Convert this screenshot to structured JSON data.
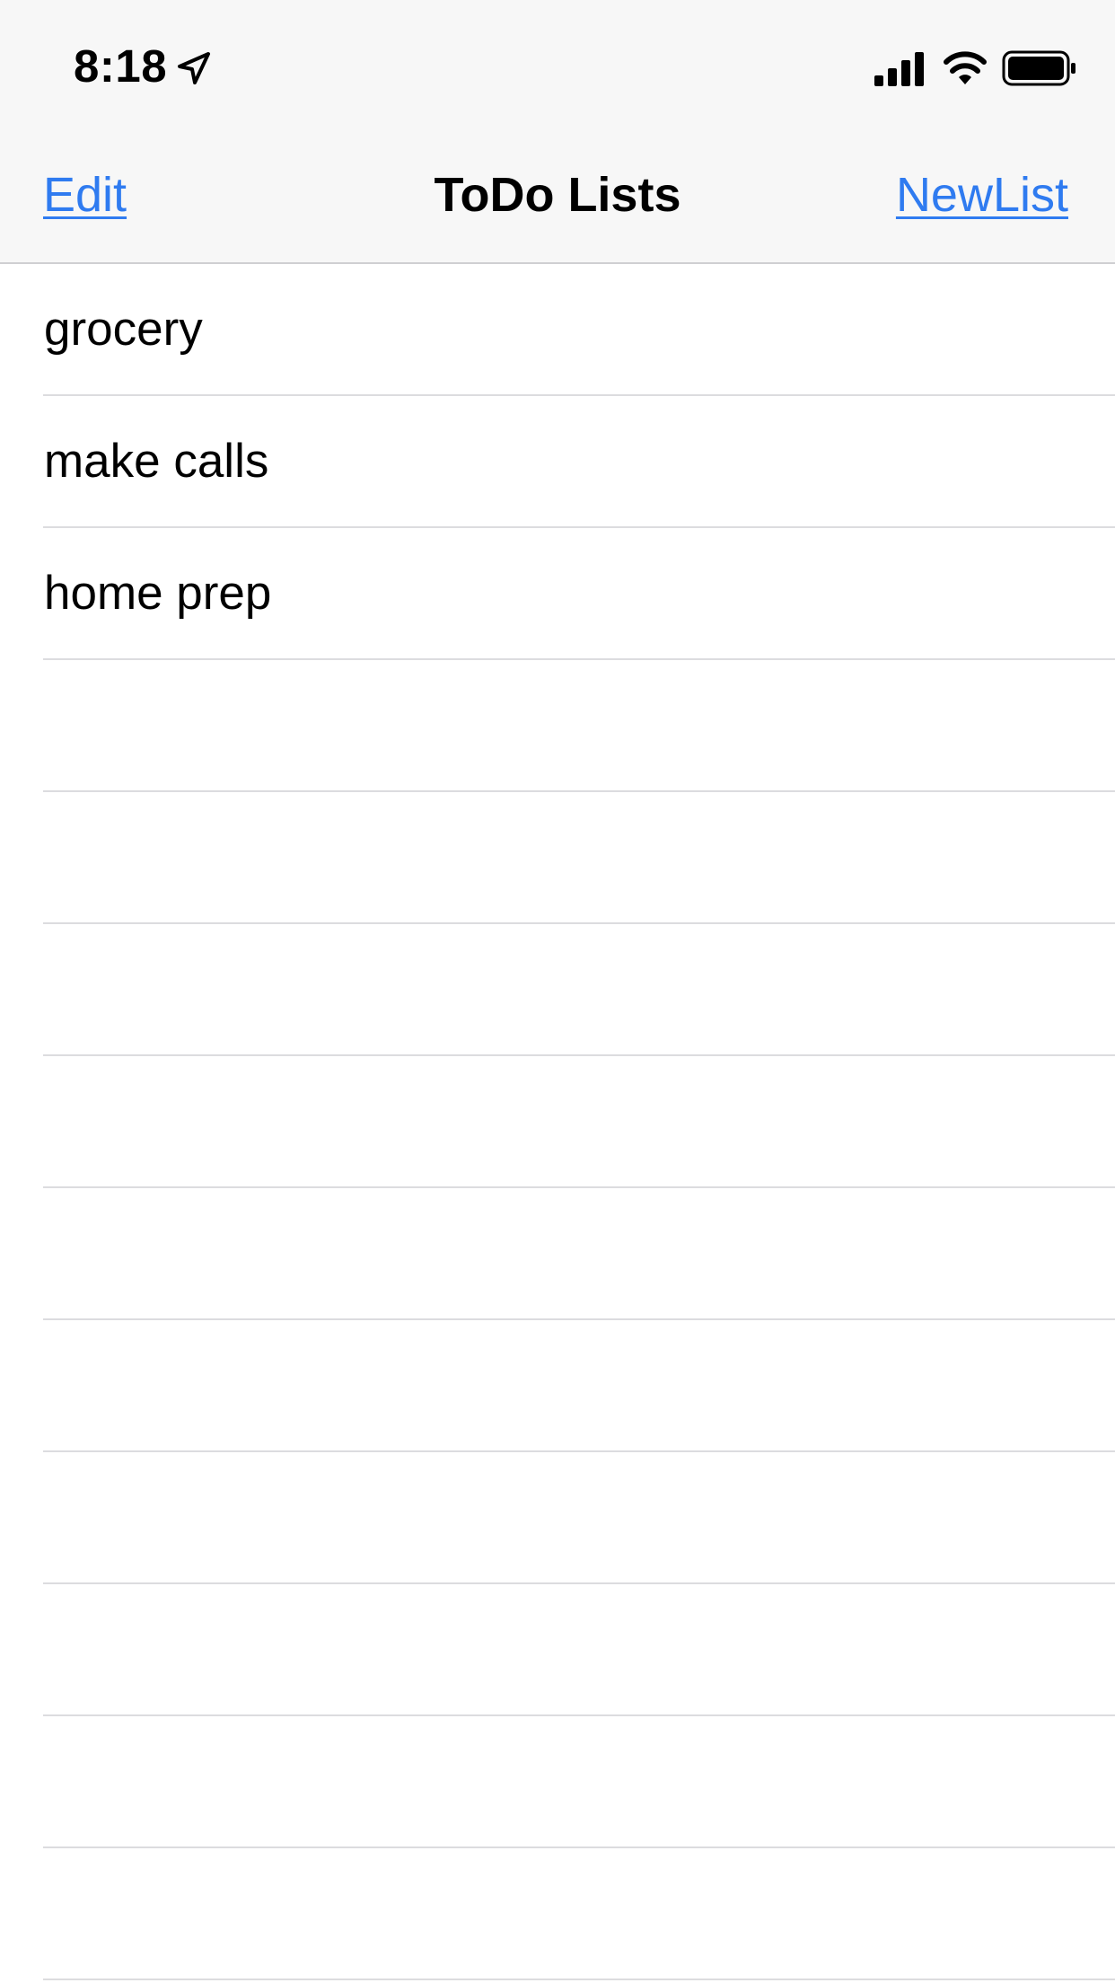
{
  "status_bar": {
    "time": "8:18",
    "icons": [
      "location-arrow-icon",
      "cellular-signal-icon",
      "wifi-icon",
      "battery-icon"
    ]
  },
  "nav_bar": {
    "title": "ToDo Lists",
    "left_button": "Edit",
    "right_button": "NewList"
  },
  "lists": [
    {
      "label": "grocery"
    },
    {
      "label": "make calls"
    },
    {
      "label": "home prep"
    }
  ],
  "colors": {
    "accent": "#2f7bf0",
    "bar_background": "#f7f7f7",
    "separator": "#dcdcdf"
  }
}
